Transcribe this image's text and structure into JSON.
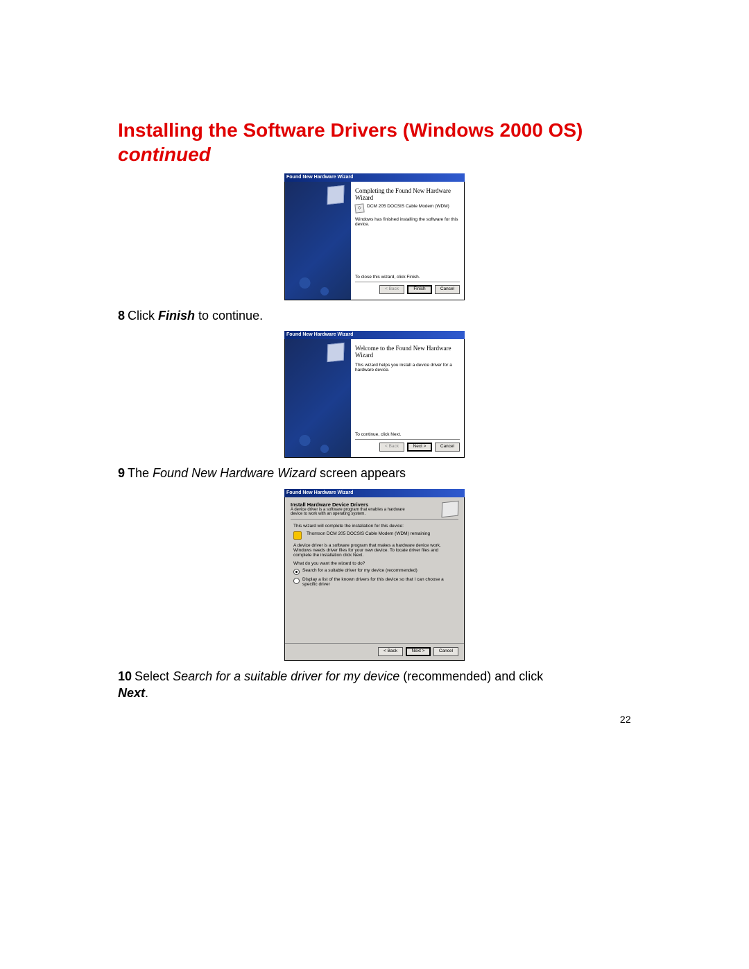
{
  "page_number": "22",
  "heading_main": "Installing the Software Drivers (Windows 2000 OS)",
  "heading_cont": "continued",
  "steps": {
    "s8": {
      "num": "8",
      "before": "Click ",
      "bold": "Finish",
      "after": " to continue."
    },
    "s9": {
      "num": "9",
      "before": "The ",
      "ital": "Found New Hardware Wizard",
      "after": " screen appears"
    },
    "s10": {
      "num": "10",
      "before": "Select ",
      "ital": "Search for a suitable driver for my device",
      "after_ital": " (recommended) and click",
      "newline_bold": "Next",
      "period": "."
    }
  },
  "win_common_title": "Found New Hardware Wizard",
  "buttons": {
    "back": "< Back",
    "next": "Next >",
    "finish": "Finish",
    "cancel": "Cancel"
  },
  "screen1": {
    "heading": "Completing the Found New Hardware Wizard",
    "device": "DCM 205 DOCSIS Cable Modem (WDM)",
    "msg": "Windows has finished installing the software for this device.",
    "close_hint": "To close this wizard, click Finish."
  },
  "screen2": {
    "heading": "Welcome to the Found New Hardware Wizard",
    "msg": "This wizard helps you install a device driver for a hardware device.",
    "continue_hint": "To continue, click Next."
  },
  "screen3": {
    "header_title": "Install Hardware Device Drivers",
    "header_desc": "A device driver is a software program that enables a hardware device to work with an operating system.",
    "intro": "This wizard will complete the installation for this device:",
    "device": "Thomson DCM 205 DOCSIS Cable Modem (WDM) remaining",
    "explain": "A device driver is a software program that makes a hardware device work. Windows needs driver files for your new device. To locate driver files and complete the installation click Next.",
    "question": "What do you want the wizard to do?",
    "opt1": "Search for a suitable driver for my device (recommended)",
    "opt2": "Display a list of the known drivers for this device so that I can choose a specific driver"
  }
}
